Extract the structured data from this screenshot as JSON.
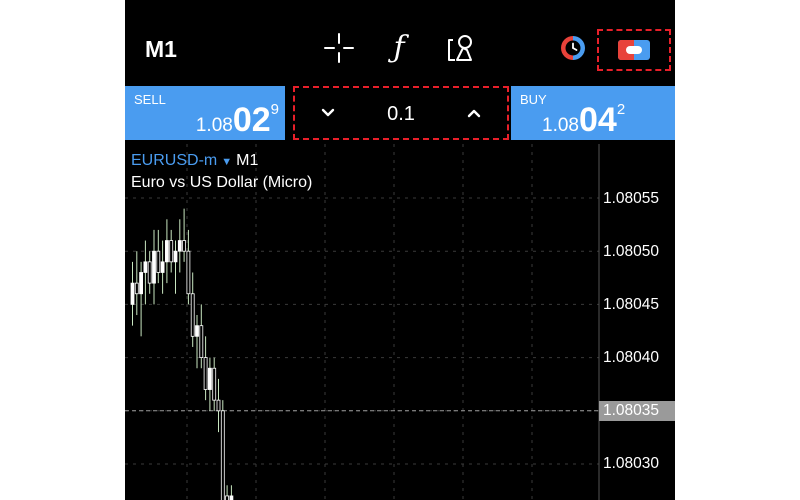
{
  "toolbar": {
    "timeframe": "M1",
    "icons": [
      "crosshair-icon",
      "function-icon",
      "objects-icon",
      "one-click-trading-icon",
      "trade-panel-icon"
    ],
    "function_glyph": "ƒ"
  },
  "quote": {
    "sell": {
      "label": "SELL",
      "price_prefix": "1.08",
      "price_big": "02",
      "price_sup": "9"
    },
    "buy": {
      "label": "BUY",
      "price_prefix": "1.08",
      "price_big": "04",
      "price_sup": "2"
    },
    "volume": "0.1"
  },
  "chart": {
    "symbol": "EURUSD-m",
    "caret": "▼",
    "timeframe": "M1",
    "description": "Euro vs US Dollar (Micro)",
    "price_ticks": [
      "1.08055",
      "1.08050",
      "1.08045",
      "1.08040",
      "1.08035",
      "1.08030"
    ],
    "current_price": "1.08035"
  },
  "colors": {
    "background": "#000000",
    "panel_blue": "#4a9cf0",
    "highlight_red": "#e8202a",
    "grid": "#3a3a3a",
    "candle_bull": "#ffffff",
    "candle_bear": "#ffffff",
    "wick": "#c8e6c0"
  },
  "chart_data": {
    "type": "candlestick",
    "ylim": [
      1.08025,
      1.0806
    ],
    "candles": [
      {
        "o": 1.08045,
        "h": 1.08049,
        "l": 1.08043,
        "c": 1.08047
      },
      {
        "o": 1.08047,
        "h": 1.0805,
        "l": 1.08044,
        "c": 1.08046
      },
      {
        "o": 1.08046,
        "h": 1.08049,
        "l": 1.08042,
        "c": 1.08048
      },
      {
        "o": 1.08048,
        "h": 1.08051,
        "l": 1.08045,
        "c": 1.08049
      },
      {
        "o": 1.08049,
        "h": 1.0805,
        "l": 1.08046,
        "c": 1.08047
      },
      {
        "o": 1.08047,
        "h": 1.08052,
        "l": 1.08045,
        "c": 1.0805
      },
      {
        "o": 1.0805,
        "h": 1.08052,
        "l": 1.08047,
        "c": 1.08048
      },
      {
        "o": 1.08048,
        "h": 1.08051,
        "l": 1.08046,
        "c": 1.08049
      },
      {
        "o": 1.08049,
        "h": 1.08053,
        "l": 1.08047,
        "c": 1.08051
      },
      {
        "o": 1.08051,
        "h": 1.08052,
        "l": 1.08048,
        "c": 1.08049
      },
      {
        "o": 1.08049,
        "h": 1.08051,
        "l": 1.08046,
        "c": 1.0805
      },
      {
        "o": 1.0805,
        "h": 1.08053,
        "l": 1.08048,
        "c": 1.08051
      },
      {
        "o": 1.08051,
        "h": 1.08054,
        "l": 1.08049,
        "c": 1.0805
      },
      {
        "o": 1.0805,
        "h": 1.08052,
        "l": 1.08045,
        "c": 1.08046
      },
      {
        "o": 1.08046,
        "h": 1.08048,
        "l": 1.08041,
        "c": 1.08042
      },
      {
        "o": 1.08042,
        "h": 1.08044,
        "l": 1.08039,
        "c": 1.08043
      },
      {
        "o": 1.08043,
        "h": 1.08045,
        "l": 1.08039,
        "c": 1.0804
      },
      {
        "o": 1.0804,
        "h": 1.08042,
        "l": 1.08036,
        "c": 1.08037
      },
      {
        "o": 1.08037,
        "h": 1.0804,
        "l": 1.08035,
        "c": 1.08039
      },
      {
        "o": 1.08039,
        "h": 1.0804,
        "l": 1.08035,
        "c": 1.08036
      },
      {
        "o": 1.08036,
        "h": 1.08038,
        "l": 1.08033,
        "c": 1.08035
      },
      {
        "o": 1.08035,
        "h": 1.08036,
        "l": 1.08024,
        "c": 1.08025
      },
      {
        "o": 1.08027,
        "h": 1.08028,
        "l": 1.08024,
        "c": 1.08026
      },
      {
        "o": 1.08026,
        "h": 1.08028,
        "l": 1.08024,
        "c": 1.08027
      }
    ]
  }
}
